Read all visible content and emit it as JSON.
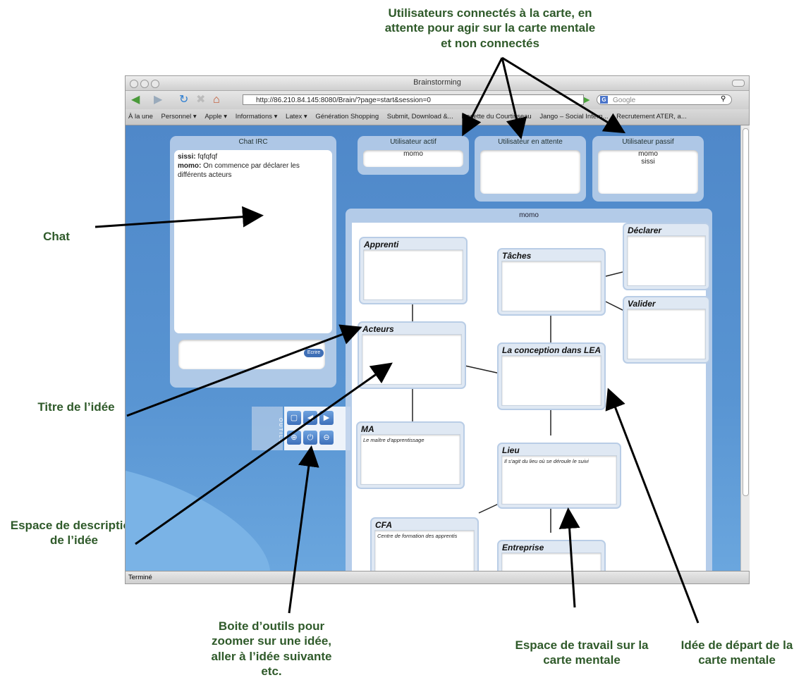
{
  "annotations": {
    "top": [
      "Utilisateurs connectés à la carte, en",
      "attente pour agir sur la carte mentale",
      "et non connectés"
    ],
    "chat": "Chat",
    "titre": "Titre de l’idée",
    "espace_desc": [
      "Espace de description",
      "de l’idée"
    ],
    "boite": [
      "Boite d’outils pour",
      "zoomer sur une idée,",
      "aller à l’idée suivante",
      "etc."
    ],
    "espace_travail": [
      "Espace de travail sur la",
      "carte mentale"
    ],
    "idee_depart": [
      "Idée de départ de la",
      "carte mentale"
    ]
  },
  "browser": {
    "title": "Brainstorming",
    "url": "http://86.210.84.145:8080/Brain/?page=start&session=0",
    "search_placeholder": "Google",
    "bookmarks": [
      "À la une",
      "Personnel ▾",
      "Apple ▾",
      "Informations ▾",
      "Latex ▾",
      "Génération Shopping",
      "Submit, Download &...",
      "Recette du Courtisseau",
      "Jango – Social Intern...",
      "Recrutement ATER, a..."
    ],
    "status": "Terminé"
  },
  "chat": {
    "title": "Chat IRC",
    "messages": [
      {
        "user": "sissi:",
        "text": " fqfqfqf"
      },
      {
        "user": "momo:",
        "text": " On commence par déclarer les différents acteurs"
      }
    ],
    "send_label": "Ecrire"
  },
  "users": {
    "active": {
      "title": "Utilisateur actif",
      "names": [
        "momo"
      ]
    },
    "waiting": {
      "title": "Utilisateur en attente",
      "names": []
    },
    "passive": {
      "title": "Utilisateur passif",
      "names": [
        "momo",
        "sissi"
      ]
    }
  },
  "toolbox": {
    "label": "O U T I L S"
  },
  "workspace": {
    "owner": "momo",
    "ideas": [
      {
        "title": "Apprenti",
        "desc": ""
      },
      {
        "title": "Tâches",
        "desc": ""
      },
      {
        "title": "Déclarer",
        "desc": ""
      },
      {
        "title": "Valider",
        "desc": ""
      },
      {
        "title": "Acteurs",
        "desc": ""
      },
      {
        "title": "La conception dans LEA",
        "desc": ""
      },
      {
        "title": "MA",
        "desc": "Le maître d'apprentissage"
      },
      {
        "title": "Lieu",
        "desc": "Il s'agit du lieu où se déroule le suivi"
      },
      {
        "title": "CFA",
        "desc": "Centre de formation des apprentis"
      },
      {
        "title": "Entreprise",
        "desc": ""
      }
    ]
  }
}
